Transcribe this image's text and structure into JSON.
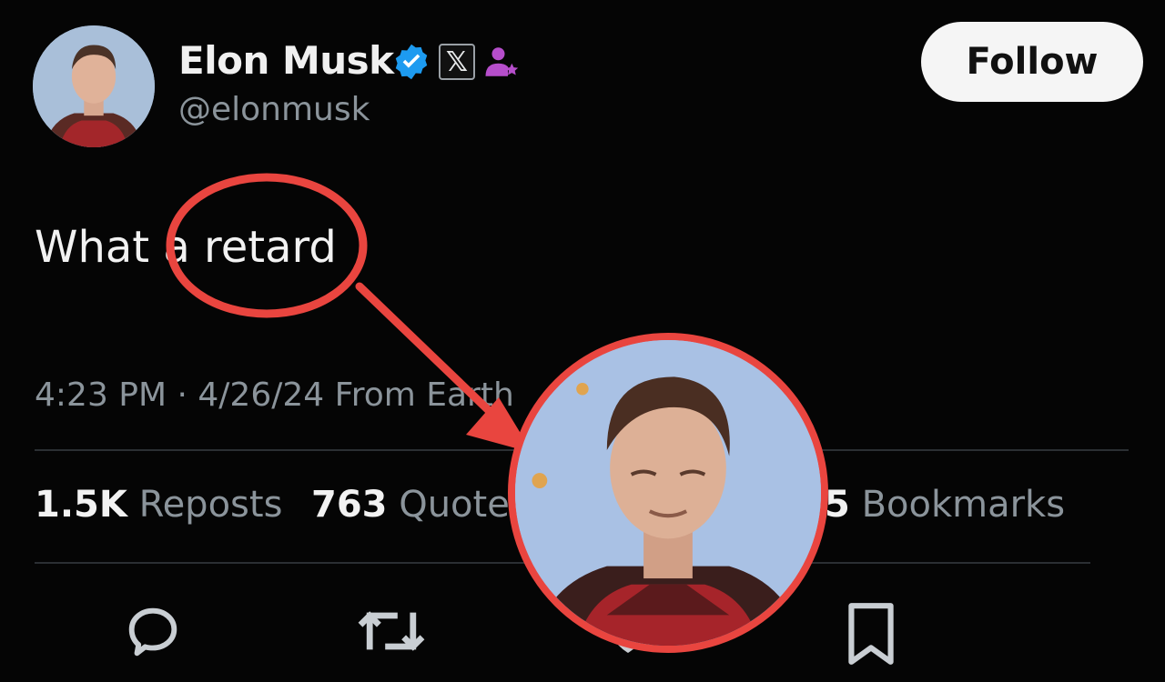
{
  "profile": {
    "display_name": "Elon Musk",
    "handle": "@elonmusk",
    "follow_label": "Follow",
    "x_badge": "𝕏"
  },
  "tweet": {
    "text": "What a retard",
    "timestamp": "4:23 PM · 4/26/24 From Earth"
  },
  "stats": {
    "reposts_count": "1.5K",
    "reposts_label": "Reposts",
    "quotes_count": "763",
    "quotes_label": "Quotes",
    "bookmarks_count": "5",
    "bookmarks_label": "Bookmarks"
  },
  "icons": {
    "verified": "verified-badge-icon",
    "affiliate": "affiliate-person-icon",
    "reply": "reply-icon",
    "repost": "repost-icon",
    "like": "like-icon",
    "bookmark": "bookmark-icon"
  },
  "colors": {
    "background": "#050505",
    "annotation_red": "#e9453f",
    "verified_blue": "#1d9bf0",
    "affiliate_purple": "#b64ecb"
  }
}
